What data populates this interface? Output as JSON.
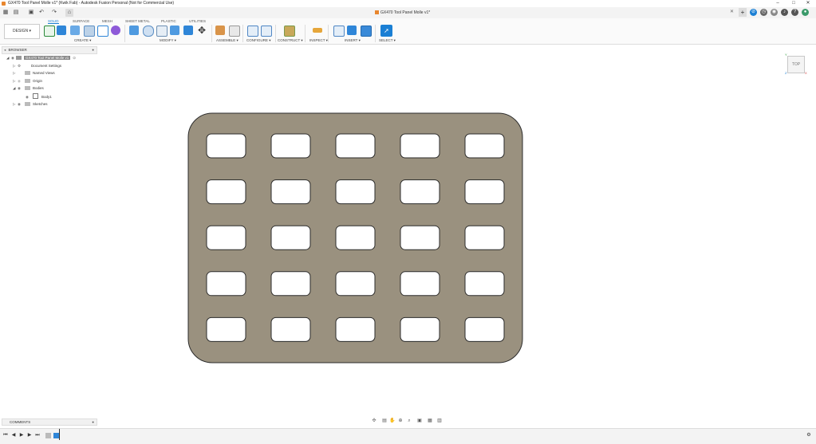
{
  "window": {
    "title": "GX470 Tool Panel Molle v1* (Kwik Fab) - Autodesk Fusion Personal (Not for Commercial Use)",
    "minimize": "–",
    "maximize": "□",
    "close": "✕"
  },
  "document_tab": {
    "name": "GX470 Tool Panel Molle v1*",
    "close": "✕"
  },
  "workspace": {
    "label": "DESIGN ▾"
  },
  "ribbon_tabs": [
    "SOLID",
    "SURFACE",
    "MESH",
    "SHEET METAL",
    "PLASTIC",
    "UTILITIES"
  ],
  "ribbon_groups": [
    "CREATE ▾",
    "MODIFY ▾",
    "ASSEMBLE ▾",
    "CONFIGURE ▾",
    "CONSTRUCT ▾",
    "INSPECT ▾",
    "INSERT ▾",
    "SELECT ▾"
  ],
  "browser": {
    "header": "BROWSER",
    "root": "GX470 Tool Panel Molle v1",
    "items": [
      "Document Settings",
      "Named Views",
      "Origin",
      "Bodies",
      "Body1",
      "Sketches"
    ]
  },
  "viewcube": {
    "face": "TOP"
  },
  "comments": {
    "header": "COMMENTS"
  },
  "canvas": {
    "panel_color": "#9a917f",
    "hole_rows": 5,
    "hole_cols": 5
  },
  "colors": {
    "accent": "#1a7fd4",
    "app_icon": "#e8862e"
  }
}
